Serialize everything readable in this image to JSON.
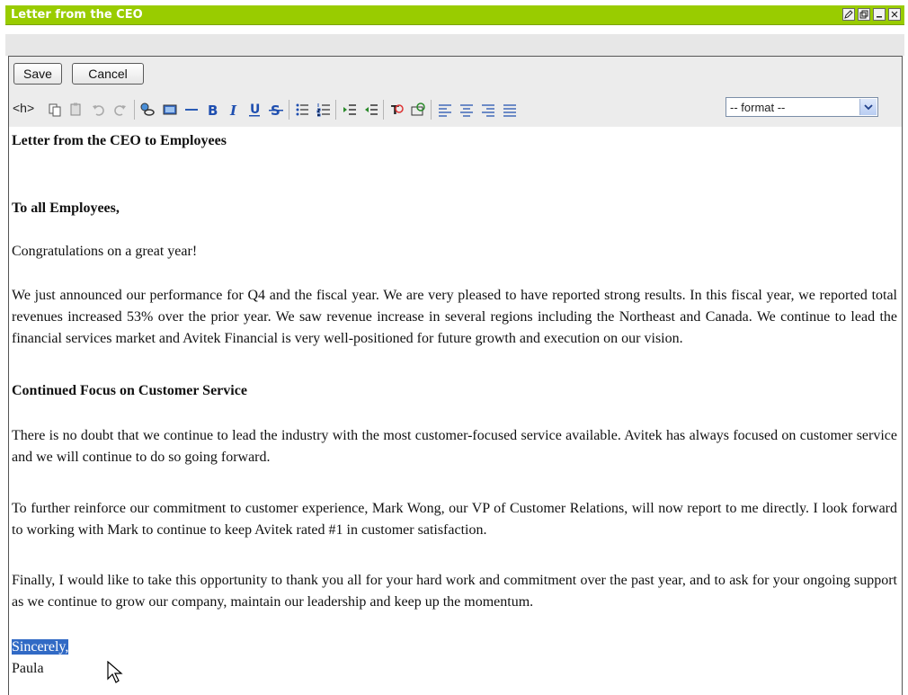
{
  "window": {
    "title": "Letter from the CEO"
  },
  "toolbar": {
    "save_label": "Save",
    "cancel_label": "Cancel",
    "html_label": "<h>",
    "format_selected": "-- format --"
  },
  "document": {
    "title": "Letter from the CEO to Employees",
    "salutation": "To all Employees,",
    "p1": "Congratulations on a great year!",
    "p2": "We just announced our performance for Q4 and the fiscal year. We are very pleased to have reported strong results. In this fiscal year, we reported total revenues increased 53% over the prior year. We saw revenue increase in several regions including the Northeast and Canada. We continue to lead the financial services market and Avitek Financial is very well-positioned for future growth and execution on our vision.",
    "heading2": "Continued Focus on Customer Service",
    "p3": "There is no doubt that we continue to lead the industry with the most customer-focused service available. Avitek has always focused on customer service and we will continue to do so going forward.",
    "p4": "To further reinforce our commitment to customer experience, Mark Wong, our VP of Customer Relations, will now report to me directly. I look forward to working with Mark to continue to keep Avitek rated #1 in customer satisfaction.",
    "p5": "Finally, I would like to take this opportunity to thank you all for your hard work and commitment over the past year, and to ask for your ongoing support as we continue to grow our company, maintain our leadership and keep up the momentum.",
    "closing": "Sincerely,",
    "signature": "Paula"
  },
  "colors": {
    "titlebar": "#99cc00",
    "selection": "#316ac5"
  }
}
